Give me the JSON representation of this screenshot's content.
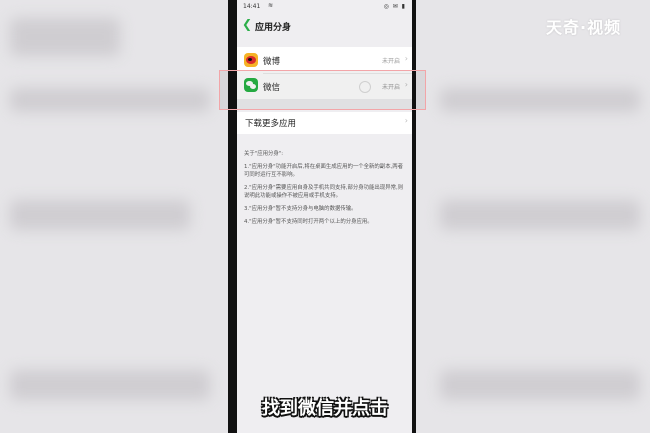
{
  "status_bar": {
    "time": "14:41",
    "wifi": "≋",
    "right_icons": "◎ ✉ ▮"
  },
  "nav": {
    "title": "应用分身"
  },
  "apps": [
    {
      "name": "微博",
      "status": "未开启"
    },
    {
      "name": "微信",
      "status": "未开启"
    }
  ],
  "download_more": {
    "label": "下载更多应用"
  },
  "info": {
    "heading": "关于\"应用分身\":",
    "items": [
      "1.\"应用分身\"功能开启后,将在桌面生成应用的一个全新的副本,两者可同时运行互不影响。",
      "2.\"应用分身\"需要应用自身及手机共同支持,部分身功能出现异常,则说明此功能或操作不被应用或手机支持。",
      "3.\"应用分身\"暂不支持分身与电脑的数据传输。",
      "4.\"应用分身\"暂不支持同时打开两个以上的分身应用。"
    ]
  },
  "watermark": "天奇·视频",
  "subtitle": "找到微信并点击"
}
